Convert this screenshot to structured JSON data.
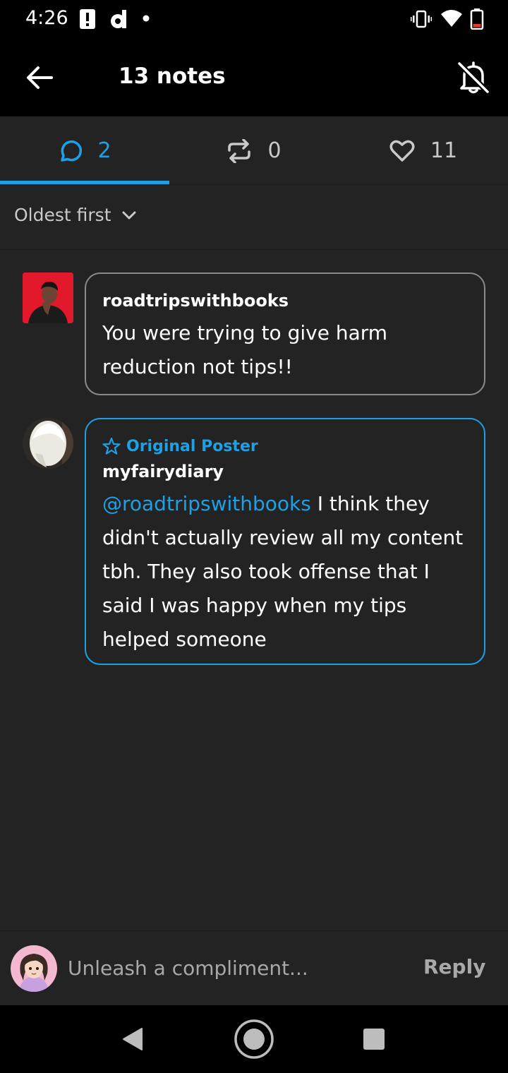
{
  "status_bar": {
    "time": "4:26",
    "icons": [
      "alert-icon",
      "d-app-icon",
      "dot-icon",
      "vibrate-icon",
      "wifi-icon",
      "battery-icon"
    ]
  },
  "header": {
    "title": "13 notes",
    "back_icon": "arrow-left-icon",
    "notifications_icon": "bell-off-icon"
  },
  "tabs": [
    {
      "icon": "comment-icon",
      "count": "2",
      "active": true
    },
    {
      "icon": "reblog-icon",
      "count": "0",
      "active": false
    },
    {
      "icon": "heart-icon",
      "count": "11",
      "active": false
    }
  ],
  "sort": {
    "label": "Oldest first",
    "icon": "chevron-down-icon"
  },
  "comments": [
    {
      "username": "roadtripswithbooks",
      "text": "You were trying to give harm reduction not tips!!",
      "original_poster": false
    },
    {
      "op_label": "Original Poster",
      "username": "myfairydiary",
      "mention": "@roadtripswithbooks",
      "text": " I think they didn't actually review all my content tbh. They also took offense that I said I was happy when my tips helped someone",
      "original_poster": true
    }
  ],
  "reply": {
    "placeholder": "Unleash a compliment...",
    "button_label": "Reply"
  },
  "colors": {
    "accent": "#1ea0e4",
    "background": "#232323",
    "bar": "#000000"
  }
}
